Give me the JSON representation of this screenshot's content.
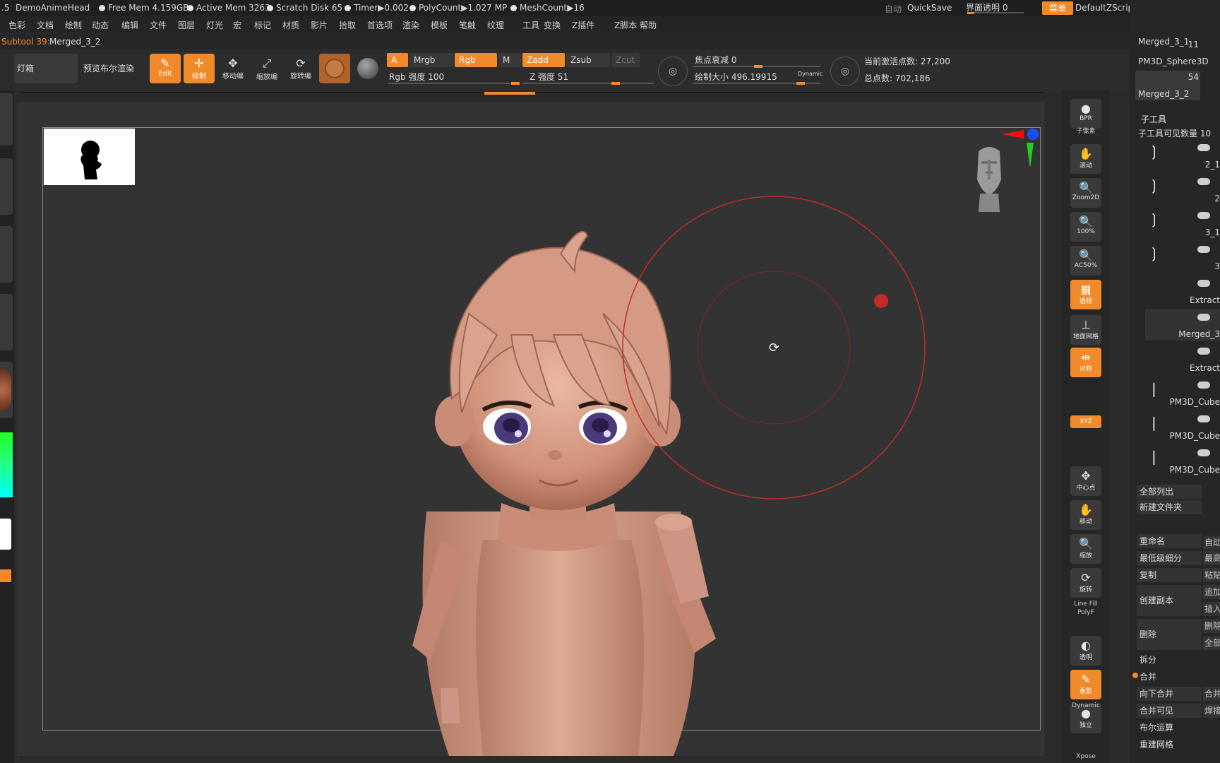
{
  "status": {
    "prefix": ".5",
    "project": "DemoAnimeHead",
    "free_mem": "Free Mem 4.159GB",
    "active_mem": "Active Mem 3263",
    "scratch_disk": "Scratch Disk 65",
    "timer": "Timer▶0.002",
    "polycount": "PolyCount▶1.027 MP",
    "meshcount": "MeshCount▶16",
    "auto": "自动",
    "quicksave": "QuickSave",
    "transparency": "界面透明 0",
    "menu_btn": "菜单",
    "script": "DefaultZScript"
  },
  "menu": [
    "色彩",
    "文档",
    "绘制",
    "动态",
    "编辑",
    "文件",
    "图层",
    "灯光",
    "宏",
    "标记",
    "材质",
    "影片",
    "拾取",
    "首选项",
    "渲染",
    "模板",
    "笔触",
    "纹理",
    "工具",
    "变换",
    "Z插件",
    "Z脚本",
    "帮助"
  ],
  "subtool_label": "Subtool 39:",
  "subtool_name": "Merged_3_2",
  "toolbar": {
    "lightbox": "灯箱",
    "preview": "预览布尔渲染",
    "edit": "Edit",
    "draw": "绘制",
    "move": "移动编",
    "scale": "缩放编",
    "rotate": "旋转编",
    "a": "A",
    "mrgb": "Mrgb",
    "rgb": "Rgb",
    "m": "M",
    "zadd": "Zadd",
    "zsub": "Zsub",
    "zcut": "Zcut",
    "rgb_intensity": "Rgb 强度 100",
    "z_intensity": "Z 强度 51",
    "focal": "焦点衰减 0",
    "draw_size": "绘制大小 496.19915",
    "dynamic": "Dynamic",
    "active_points": "当前激活点数: 27,200",
    "total_points": "总点数: 702,186"
  },
  "right_shelf": [
    "BPR",
    "子像素",
    "滚动",
    "Zoom2D",
    "100%",
    "AC50%",
    "透视",
    "地面网格",
    "对称",
    "XYZ",
    "中心点",
    "移动",
    "缩放",
    "旋转",
    "Line Fill",
    "PolyF",
    "透明",
    "重影",
    "Dynamic",
    "独立",
    "Xpose"
  ],
  "panel": {
    "tools": [
      {
        "name": "Merged_3_1",
        "count": ""
      },
      {
        "name": "PM3D_Sphere3D",
        "count": "11"
      },
      {
        "name": "Merged_3_2",
        "count": "54"
      }
    ],
    "subtool_header": "子工具",
    "visible_count": "子工具可见数量 10",
    "subtools": [
      "2_1",
      "2",
      "3_1",
      "3",
      "Extract",
      "Merged_3",
      "Extract",
      "PM3D_Cube",
      "PM3D_Cube",
      "PM3D_Cube"
    ],
    "buttons": [
      "全部列出",
      "新建文件夹",
      "重命名",
      "最低级细分",
      "复制",
      "创建副本",
      "删除",
      "拆分",
      "合并",
      "向下合并",
      "合并可见",
      "布尔运算",
      "重建网格"
    ],
    "side_buttons": [
      "自动",
      "最高",
      "粘贴",
      "追加",
      "插入",
      "删除",
      "全部",
      "合并",
      "焊接"
    ]
  },
  "colors": {
    "accent": "#f08a2a",
    "skin": "#d9a08a",
    "canvas": "#333333",
    "brush": "#c22a2a"
  }
}
